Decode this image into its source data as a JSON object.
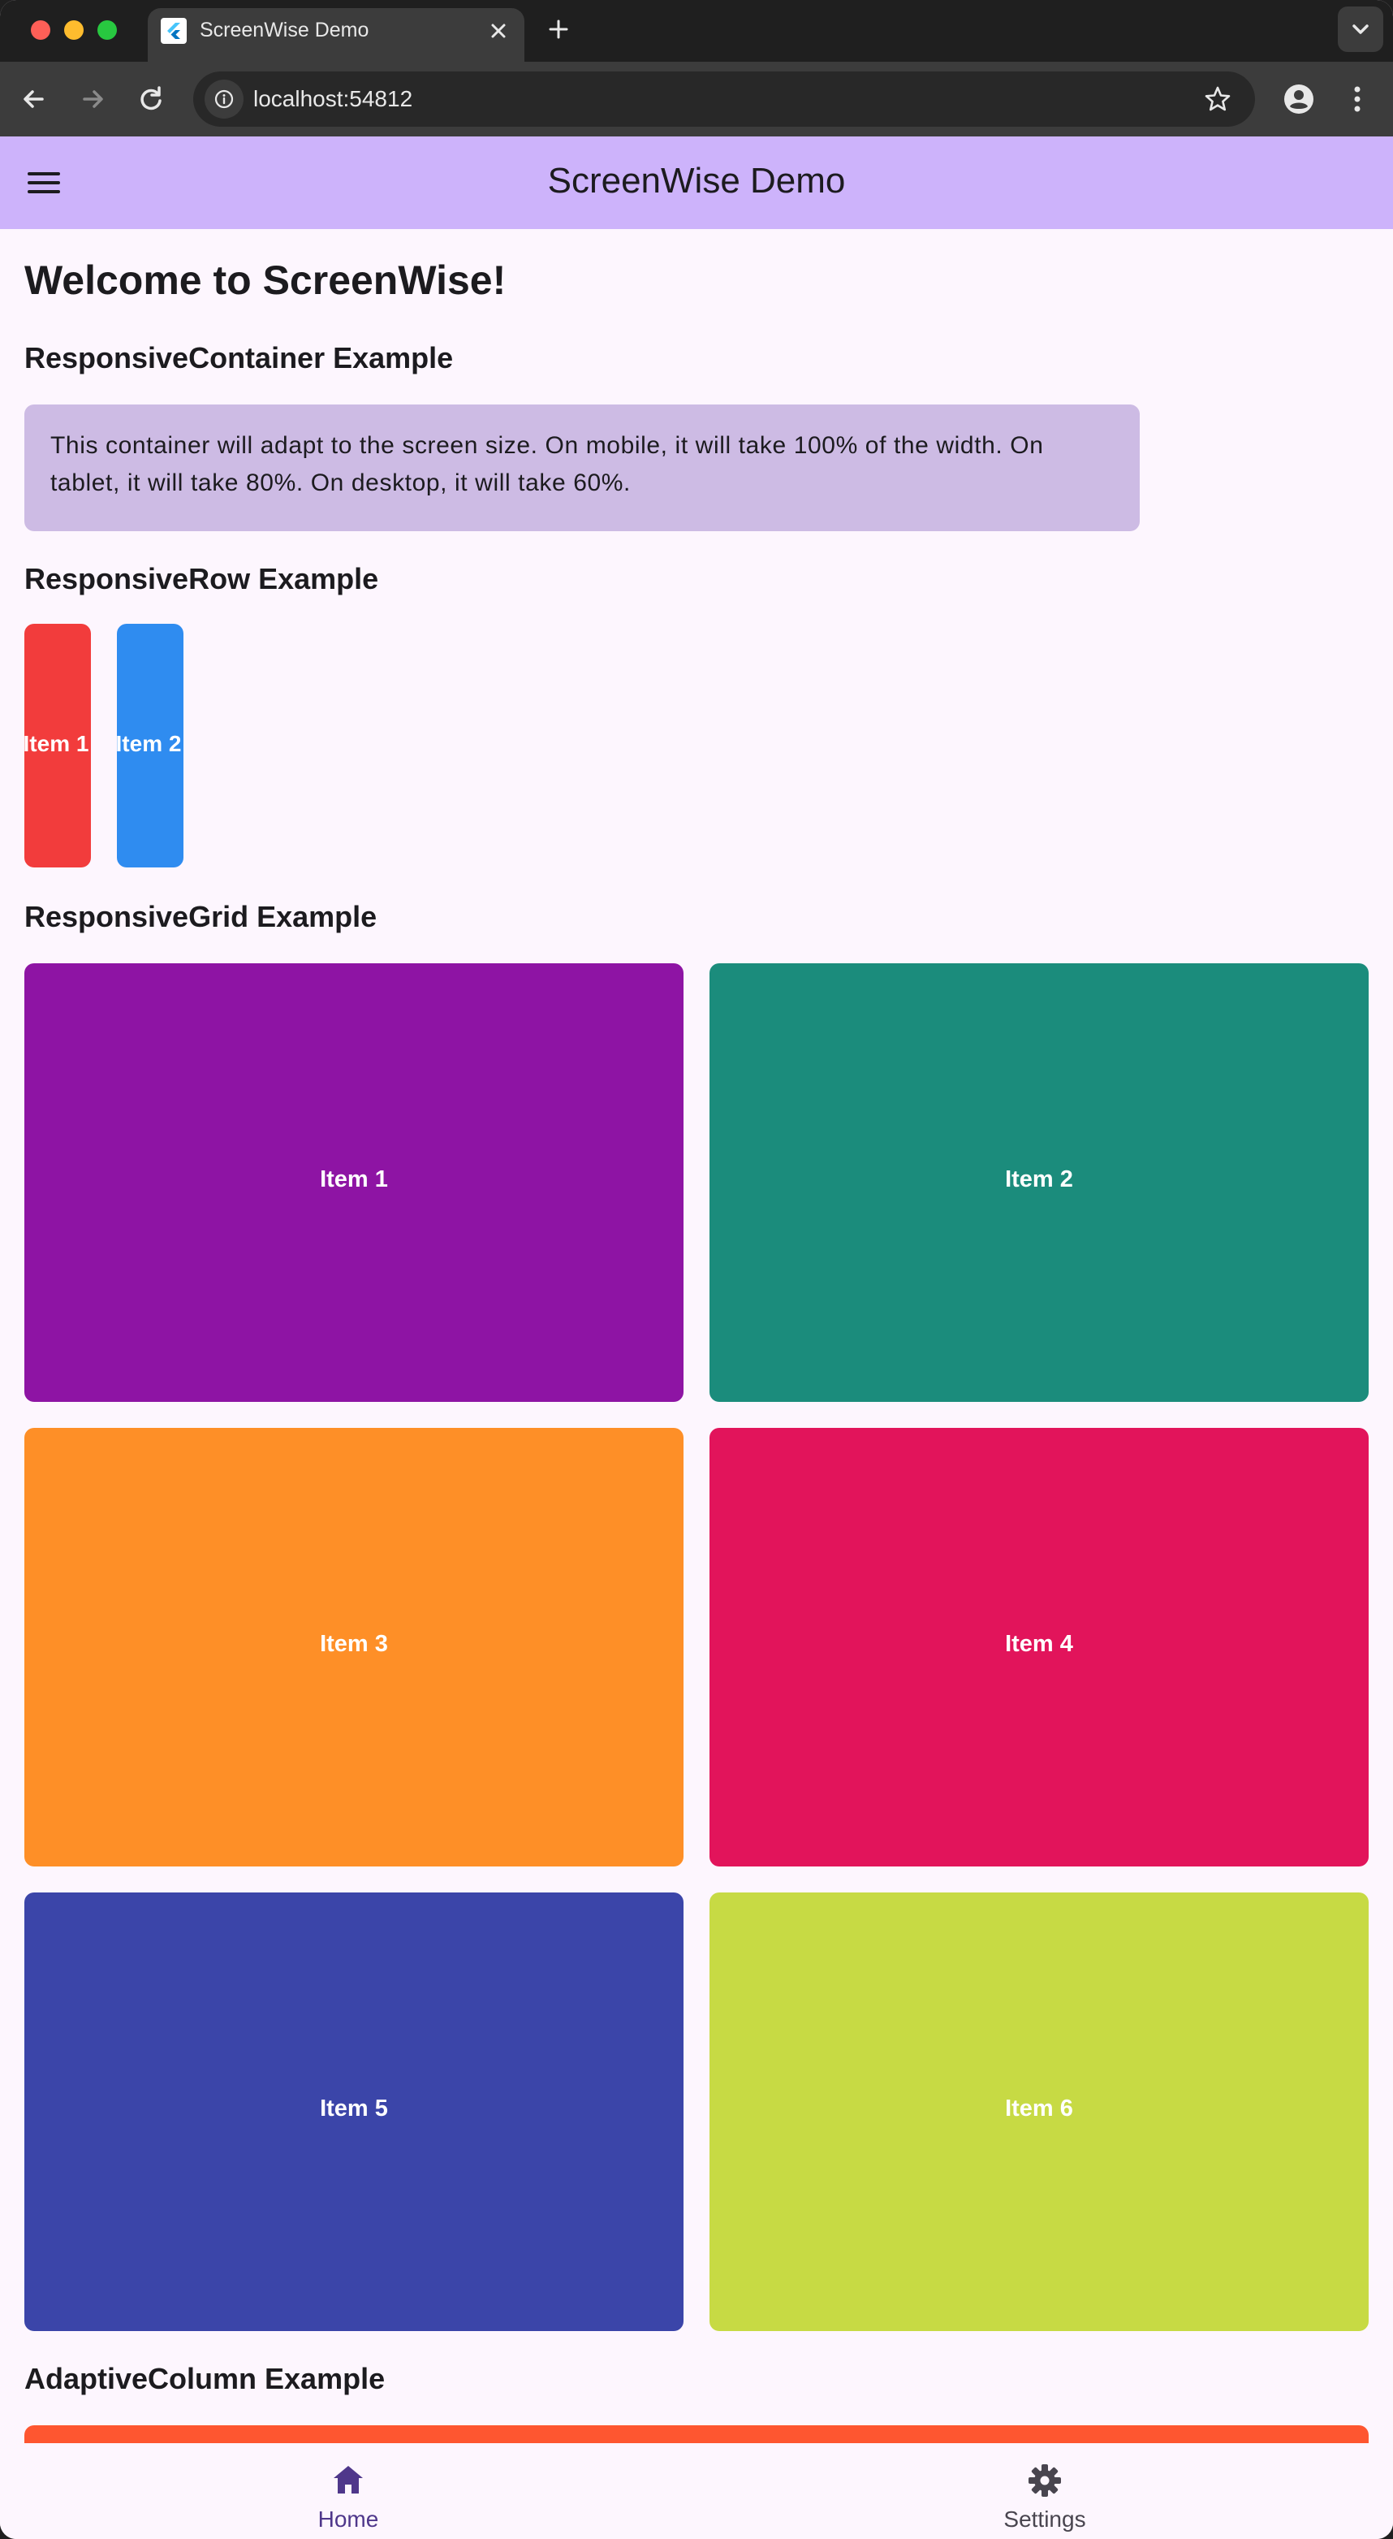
{
  "browser": {
    "tab_title": "ScreenWise Demo",
    "url": "localhost:54812"
  },
  "appbar": {
    "title": "ScreenWise Demo",
    "menu_icon": "menu-icon"
  },
  "content": {
    "welcome": "Welcome to ScreenWise!",
    "container_heading": "ResponsiveContainer Example",
    "container_text": "This container will adapt to the screen size. On mobile, it will take 100% of the width. On tablet, it will take 80%. On desktop, it will take 60%.",
    "container_color": "#cdbbe4",
    "row_heading": "ResponsiveRow Example",
    "row_items": [
      {
        "label": "Item 1",
        "color": "#f23c3c"
      },
      {
        "label": "Item 2",
        "color": "#2f8cf0"
      }
    ],
    "grid_heading": "ResponsiveGrid Example",
    "grid_items": [
      {
        "label": "Item 1",
        "color": "#8e14a4"
      },
      {
        "label": "Item 2",
        "color": "#1b8c7c"
      },
      {
        "label": "Item 3",
        "color": "#fe8f27"
      },
      {
        "label": "Item 4",
        "color": "#e2145b"
      },
      {
        "label": "Item 5",
        "color": "#3b45a9"
      },
      {
        "label": "Item 6",
        "color": "#c7da44"
      }
    ],
    "column_heading": "AdaptiveColumn Example",
    "column_first_color": "#fe5630"
  },
  "bottom_nav": {
    "items": [
      {
        "label": "Home",
        "icon": "home-icon",
        "selected": true
      },
      {
        "label": "Settings",
        "icon": "gear-icon",
        "selected": false
      }
    ],
    "selected_color": "#4f378b",
    "unselected_color": "#49454f"
  }
}
